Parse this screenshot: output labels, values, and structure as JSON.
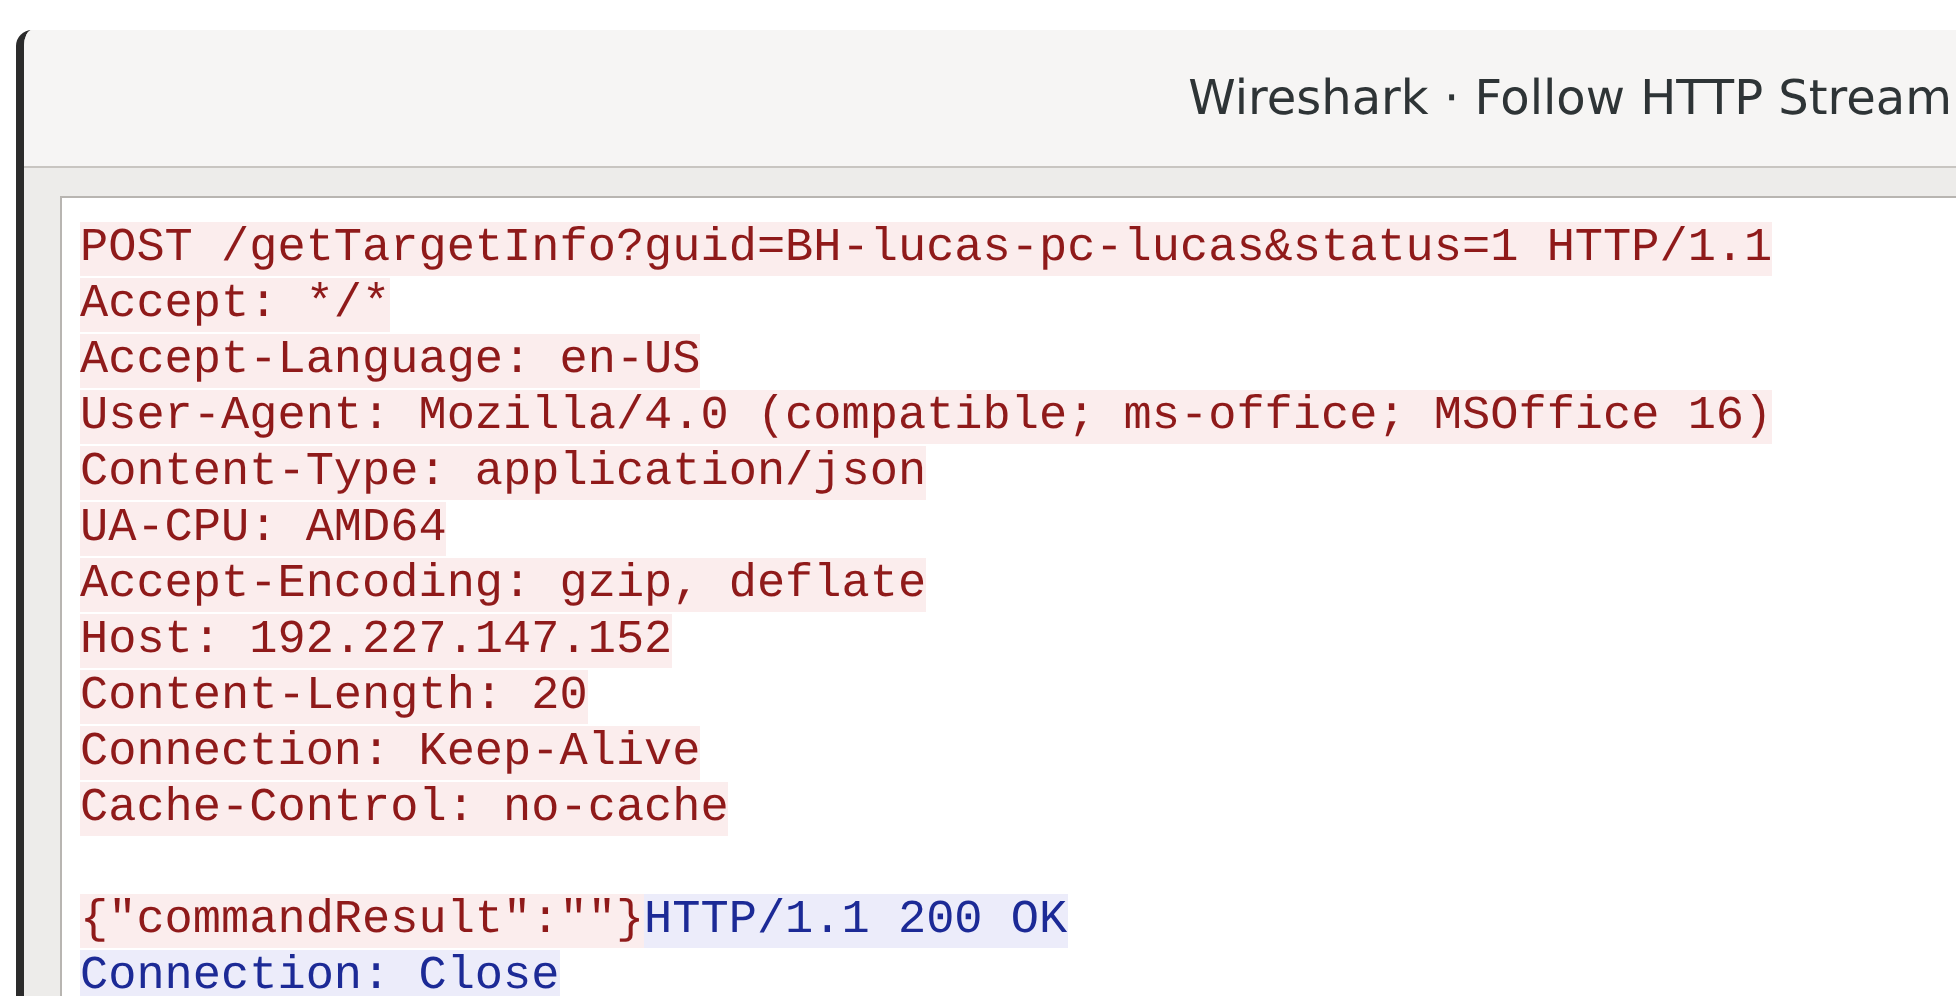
{
  "window": {
    "title": "Wireshark · Follow HTTP Stream"
  },
  "stream": [
    {
      "kind": "text",
      "segments": [
        {
          "text": "POST /getTargetInfo?guid=BH-lucas-pc-lucas&status=1 HTTP/1.1",
          "kind": "client"
        }
      ]
    },
    {
      "kind": "text",
      "segments": [
        {
          "text": "Accept: */*",
          "kind": "client"
        }
      ]
    },
    {
      "kind": "text",
      "segments": [
        {
          "text": "Accept-Language: en-US",
          "kind": "client"
        }
      ]
    },
    {
      "kind": "text",
      "segments": [
        {
          "text": "User-Agent: Mozilla/4.0 (compatible; ms-office; MSOffice 16)",
          "kind": "client"
        }
      ]
    },
    {
      "kind": "text",
      "segments": [
        {
          "text": "Content-Type: application/json",
          "kind": "client"
        }
      ]
    },
    {
      "kind": "text",
      "segments": [
        {
          "text": "UA-CPU: AMD64",
          "kind": "client"
        }
      ]
    },
    {
      "kind": "text",
      "segments": [
        {
          "text": "Accept-Encoding: gzip, deflate",
          "kind": "client"
        }
      ]
    },
    {
      "kind": "text",
      "segments": [
        {
          "text": "Host: 192.227.147.152",
          "kind": "client"
        }
      ]
    },
    {
      "kind": "text",
      "segments": [
        {
          "text": "Content-Length: 20",
          "kind": "client"
        }
      ]
    },
    {
      "kind": "text",
      "segments": [
        {
          "text": "Connection: Keep-Alive",
          "kind": "client"
        }
      ]
    },
    {
      "kind": "text",
      "segments": [
        {
          "text": "Cache-Control: no-cache",
          "kind": "client"
        }
      ]
    },
    {
      "kind": "blank"
    },
    {
      "kind": "text",
      "segments": [
        {
          "text": "{\"commandResult\":\"\"}",
          "kind": "client"
        },
        {
          "text": "HTTP/1.1 200 OK",
          "kind": "server"
        }
      ]
    },
    {
      "kind": "text",
      "segments": [
        {
          "text": "Connection: Close",
          "kind": "server"
        }
      ]
    }
  ]
}
